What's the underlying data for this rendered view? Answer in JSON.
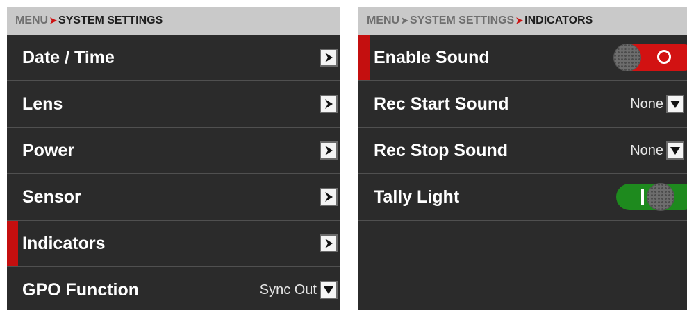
{
  "left": {
    "breadcrumb": [
      "MENU",
      "SYSTEM SETTINGS"
    ],
    "items": [
      {
        "label": "Date / Time"
      },
      {
        "label": "Lens"
      },
      {
        "label": "Power"
      },
      {
        "label": "Sensor"
      },
      {
        "label": "Indicators",
        "selected": true
      },
      {
        "label": "GPO Function",
        "value": "Sync Out"
      }
    ]
  },
  "right": {
    "breadcrumb": [
      "MENU",
      "SYSTEM SETTINGS",
      "INDICATORS"
    ],
    "items": [
      {
        "label": "Enable Sound",
        "toggle": "off",
        "selected": true
      },
      {
        "label": "Rec Start Sound",
        "value": "None"
      },
      {
        "label": "Rec Stop Sound",
        "value": "None"
      },
      {
        "label": "Tally Light",
        "toggle": "on"
      }
    ]
  },
  "colors": {
    "accent_red": "#c40f0f",
    "toggle_off": "#d21212",
    "toggle_on": "#1e8a1e",
    "panel_bg": "#2b2b2b",
    "breadcrumb_bg": "#c9c9c9"
  },
  "icons": {
    "breadcrumb_separator": "chevron-right-icon",
    "nav_button": "arrow-right-icon",
    "dropdown_button": "chevron-down-icon",
    "toggle_off_glyph": "circle-o-icon",
    "toggle_on_glyph": "bar-i-icon"
  }
}
